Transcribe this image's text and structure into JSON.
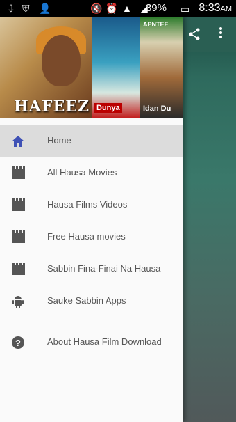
{
  "status_bar": {
    "battery": "39%",
    "time": "8:33",
    "ampm": "AM"
  },
  "banner": {
    "poster1_title": "HAFEEZ",
    "poster2_title": "Dunya",
    "poster3_title": "Idan Du",
    "poster3_top": "APNTEE"
  },
  "menu": {
    "items": [
      {
        "label": "Home",
        "icon": "home-icon",
        "active": true
      },
      {
        "label": "All Hausa Movies",
        "icon": "clapperboard-icon"
      },
      {
        "label": "Hausa Films Videos",
        "icon": "clapperboard-icon"
      },
      {
        "label": "Free Hausa movies",
        "icon": "clapperboard-icon"
      },
      {
        "label": "Sabbin Fina-Finai Na Hausa",
        "icon": "clapperboard-icon"
      },
      {
        "label": "Sauke Sabbin Apps",
        "icon": "android-icon"
      }
    ],
    "footer_item": {
      "label": "About Hausa Film Download",
      "icon": "help-icon"
    }
  },
  "colors": {
    "accent": "#3f51b5",
    "drawer_bg": "#fafafa",
    "active_bg": "#dcdcdc"
  }
}
